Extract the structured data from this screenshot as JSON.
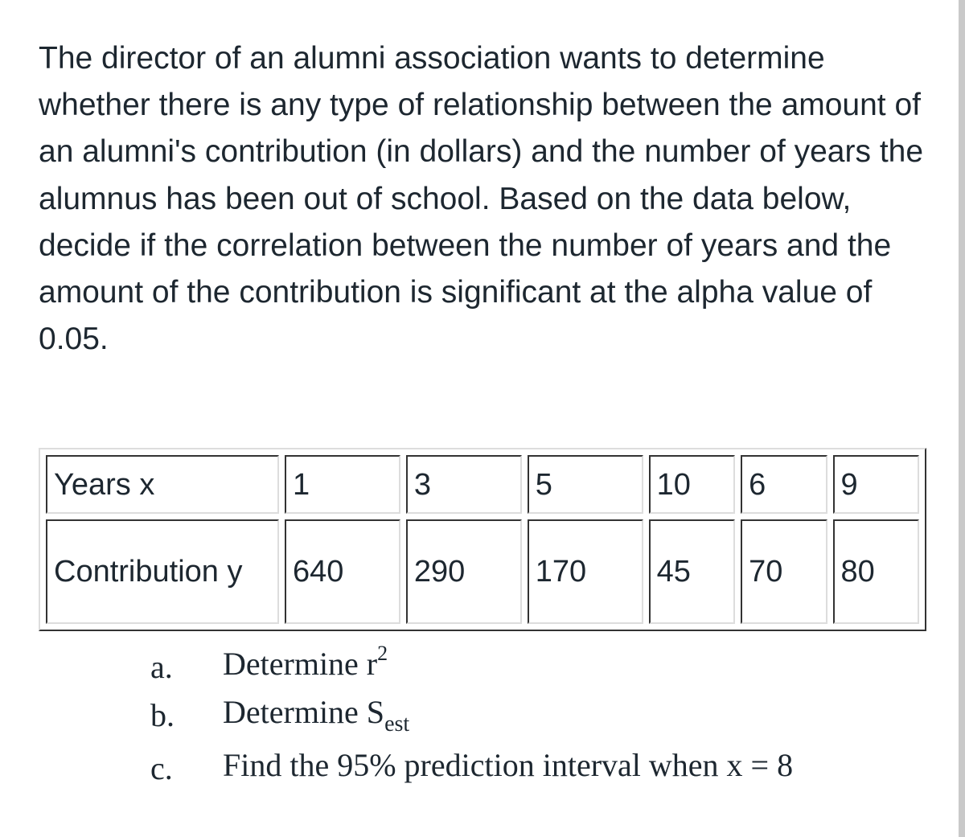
{
  "problem_text": "The director of an alumni association wants to determine whether there is any type of relationship between the amount of an alumni's contribution (in dollars) and the number of years the alumnus has been out of school.  Based on the data below, decide if the correlation between the number of years and the amount of the contribution is significant at the alpha value of 0.05.",
  "table": {
    "rows": [
      {
        "header": "Years x",
        "values": [
          "1",
          "3",
          "5",
          "10",
          "6",
          "9"
        ]
      },
      {
        "header": "Contribution y",
        "values": [
          "640",
          "290",
          "170",
          "45",
          "70",
          "80"
        ]
      }
    ]
  },
  "questions": [
    {
      "label": "a.",
      "text": "Determine r",
      "sup": "2"
    },
    {
      "label": "b.",
      "text": "Determine S",
      "sub": "est"
    },
    {
      "label": "c.",
      "text": "Find the 95% prediction interval when x = 8"
    }
  ]
}
